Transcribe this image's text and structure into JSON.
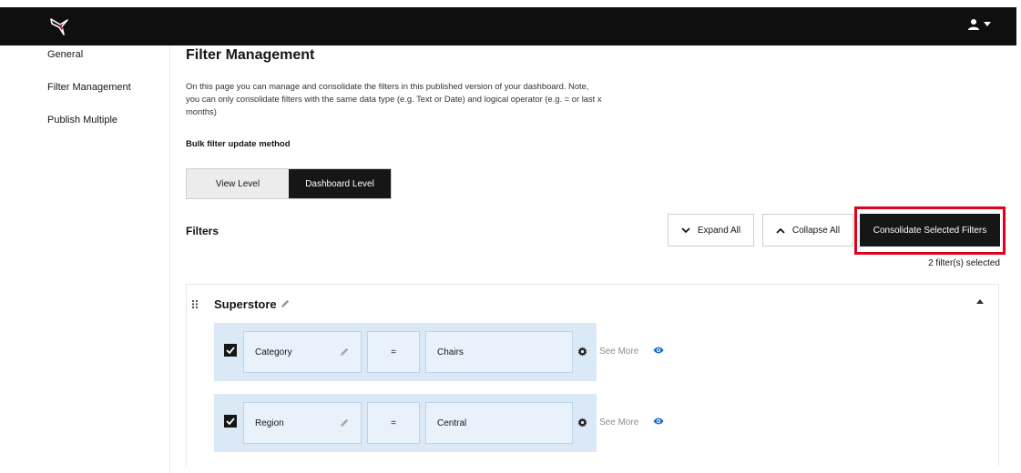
{
  "nav": {
    "logo_icon": "hummingbird-logo-icon",
    "user_icon": "user-icon",
    "dropdown_icon": "caret-down-icon"
  },
  "sidebar": {
    "items": [
      {
        "label": "General"
      },
      {
        "label": "Filter Management"
      },
      {
        "label": "Publish Multiple"
      }
    ]
  },
  "main": {
    "title": "Filter Management",
    "description": "On this page you can manage and consolidate the filters in this published version of your dashboard. Note, you can only consolidate filters with the same data type (e.g. Text or Date) and logical operator (e.g. = or last x months)",
    "bulk_label": "Bulk filter update method",
    "levels": [
      {
        "label": "View Level",
        "active": false
      },
      {
        "label": "Dashboard Level",
        "active": true
      }
    ],
    "filters_title": "Filters",
    "expand_all": "Expand All",
    "collapse_all": "Collapse All",
    "consolidate": "Consolidate Selected Filters",
    "selected_count": "2 filter(s) selected"
  },
  "group": {
    "name": "Superstore",
    "filters": [
      {
        "field": "Category",
        "operator": "=",
        "value": "Chairs",
        "checked": true,
        "see_more": "See More"
      },
      {
        "field": "Region",
        "operator": "=",
        "value": "Central",
        "checked": true,
        "see_more": "See More"
      }
    ]
  },
  "colors": {
    "highlight": "#e0001b",
    "filter_row_bg": "#dbe9f7",
    "eye_icon": "#1f6fcf",
    "dark_button": "#161616"
  }
}
